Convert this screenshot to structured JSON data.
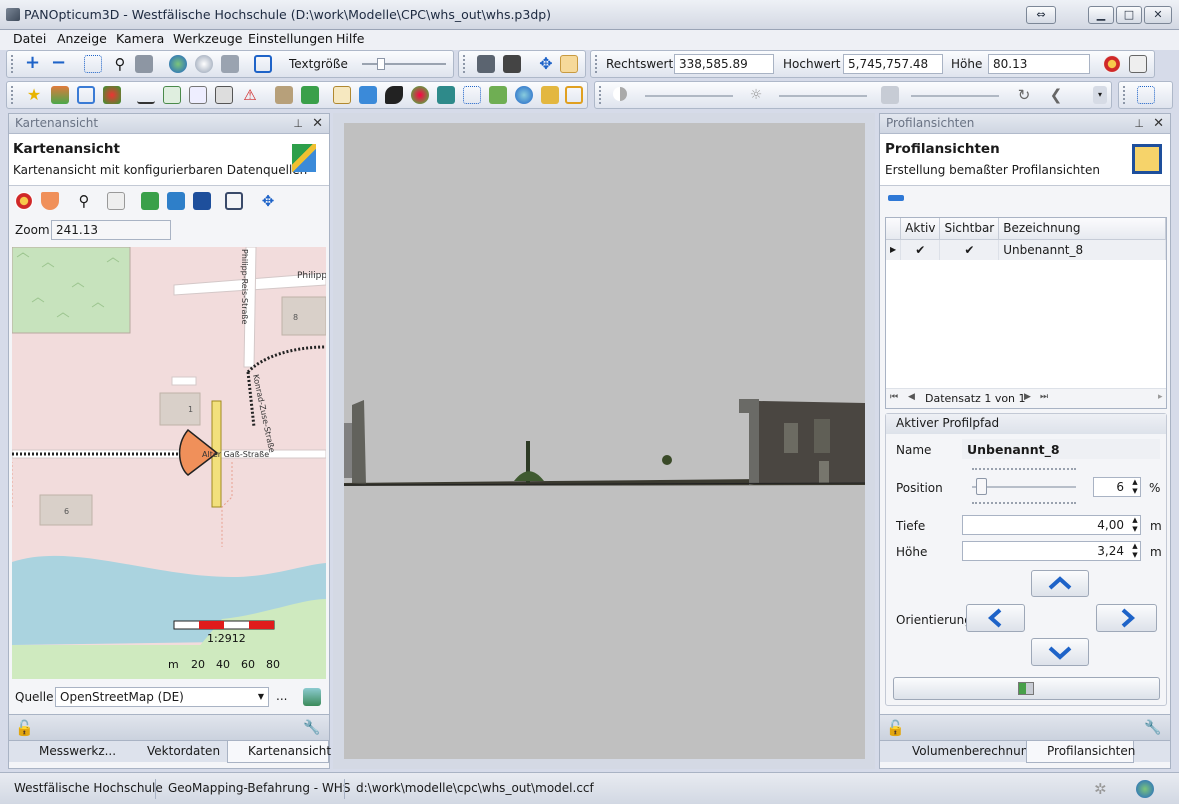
{
  "window": {
    "title": "PANOpticum3D - Westfälische Hochschule (D:\\work\\Modelle\\CPC\\whs_out\\whs.p3dp)"
  },
  "menu": [
    "Datei",
    "Anzeige",
    "Kamera",
    "Werkzeuge",
    "Einstellungen",
    "Hilfe"
  ],
  "toolbar": {
    "text_size_label": "Textgröße",
    "easting_label": "Rechtswert",
    "easting_value": "338,585.89",
    "northing_label": "Hochwert",
    "northing_value": "5,745,757.48",
    "height_label": "Höhe",
    "height_value": "80.13"
  },
  "left_panel": {
    "header": "Kartenansicht",
    "title": "Kartenansicht",
    "subtitle": "Kartenansicht mit konfigurierbaren Datenquellen",
    "zoom_label": "Zoom",
    "zoom_value": "241.13",
    "map": {
      "street1": "Philipp-",
      "street2": "Philipp-Reis-Straße",
      "street3": "Konrad-Zuse-Straße",
      "street4": "Alter Gaß-Straße",
      "house1": "1",
      "house2": "8",
      "house3": "6",
      "scale_ratio": "1:2912",
      "scale_unit": "m",
      "scale_ticks": [
        "20",
        "40",
        "60",
        "80"
      ]
    },
    "source_label": "Quelle",
    "source_value": "OpenStreetMap (DE)",
    "source_more": "...",
    "tabs": [
      "Messwerkz...",
      "Vektordaten",
      "Kartenansicht"
    ]
  },
  "right_panel": {
    "header": "Profilansichten",
    "title": "Profilansichten",
    "subtitle": "Erstellung bemaßter Profilansichten",
    "table": {
      "columns": [
        "Aktiv",
        "Sichtbar",
        "Bezeichnung"
      ],
      "rows": [
        {
          "aktiv": "✔",
          "sichtbar": "✔",
          "name": "Unbenannt_8"
        }
      ]
    },
    "nav": "Datensatz 1 von 1",
    "group": "Aktiver Profilpfad",
    "name_label": "Name",
    "name_value": "Unbenannt_8",
    "position_label": "Position",
    "position_value": "6",
    "position_unit": "%",
    "depth_label": "Tiefe",
    "depth_value": "4,00",
    "depth_unit": "m",
    "height_label": "Höhe",
    "height_value": "3,24",
    "height_unit": "m",
    "orientation_label": "Orientierung",
    "tabs": [
      "Volumenberechnung",
      "Profilansichten"
    ]
  },
  "status": {
    "org": "Westfälische Hochschule",
    "project": "GeoMapping-Befahrung - WHS",
    "path": "d:\\work\\modelle\\cpc\\whs_out\\model.ccf"
  },
  "colors": {
    "accent": "#1e63c8",
    "map_bg": "#f2dcdc",
    "viewport": "#c0c0c0",
    "fov": "#f0905a"
  }
}
